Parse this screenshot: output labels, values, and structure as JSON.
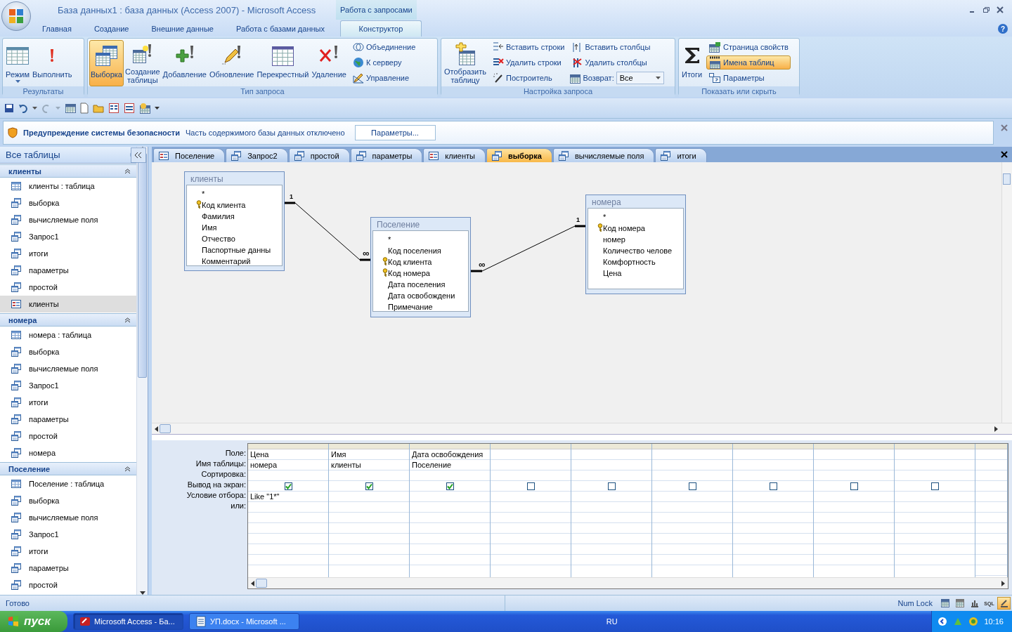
{
  "window": {
    "title": "База данных1 : база данных (Access 2007)  -  Microsoft Access",
    "context_group": "Работа с запросами",
    "help": "?"
  },
  "ribbon_tabs": [
    {
      "label": "Главная",
      "selected": false
    },
    {
      "label": "Создание",
      "selected": false
    },
    {
      "label": "Внешние данные",
      "selected": false
    },
    {
      "label": "Работа с базами данных",
      "selected": false
    },
    {
      "label": "Конструктор",
      "selected": true
    }
  ],
  "ribbon_groups": [
    {
      "title": "Результаты",
      "items": [
        {
          "kind": "large",
          "label": "Режим",
          "menu": true,
          "selected": false
        },
        {
          "kind": "large",
          "label": "Выполнить",
          "selected": false
        }
      ]
    },
    {
      "title": "Тип запроса",
      "items": [
        {
          "kind": "large",
          "label": "Выборка",
          "selected": true
        },
        {
          "kind": "large",
          "label": "Создание таблицы",
          "selected": false
        },
        {
          "kind": "large",
          "label": "Добавление",
          "selected": false
        },
        {
          "kind": "large",
          "label": "Обновление",
          "selected": false
        },
        {
          "kind": "large",
          "label": "Перекрестный",
          "selected": false
        },
        {
          "kind": "large",
          "label": "Удаление",
          "selected": false
        },
        {
          "kind": "small",
          "label": "Объединение",
          "selected": false
        },
        {
          "kind": "small",
          "label": "К серверу",
          "selected": false
        },
        {
          "kind": "small",
          "label": "Управление",
          "selected": false
        }
      ]
    },
    {
      "title": "Настройка запроса",
      "items": [
        {
          "kind": "large",
          "label": "Отобразить таблицу",
          "selected": false
        },
        {
          "kind": "small",
          "label": "Вставить строки",
          "selected": false
        },
        {
          "kind": "small",
          "label": "Удалить строки",
          "selected": false
        },
        {
          "kind": "small",
          "label": "Построитель",
          "selected": false
        },
        {
          "kind": "small",
          "label": "Вставить столбцы",
          "selected": false
        },
        {
          "kind": "small",
          "label": "Удалить столбцы",
          "selected": false
        },
        {
          "kind": "combo",
          "label": "Возврат:",
          "value": "Все"
        }
      ]
    },
    {
      "title": "Показать или скрыть",
      "items": [
        {
          "kind": "large",
          "label": "Итоги",
          "selected": false
        },
        {
          "kind": "small",
          "label": "Страница свойств",
          "selected": false
        },
        {
          "kind": "small",
          "label": "Имена таблиц",
          "selected": true
        },
        {
          "kind": "small",
          "label": "Параметры",
          "selected": false
        }
      ]
    }
  ],
  "security_bar": {
    "title": "Предупреждение системы безопасности",
    "message": "Часть содержимого базы данных отключено",
    "button": "Параметры..."
  },
  "nav_pane": {
    "title": "Все таблицы",
    "groups": [
      {
        "title": "клиенты",
        "expanded": true,
        "items": [
          {
            "label": "клиенты : таблица",
            "kind": "table",
            "selected": false
          },
          {
            "label": "выборка",
            "kind": "query",
            "selected": false
          },
          {
            "label": "вычисляемые поля",
            "kind": "query",
            "selected": false
          },
          {
            "label": "Запрос1",
            "kind": "query",
            "selected": false
          },
          {
            "label": "итоги",
            "kind": "query",
            "selected": false
          },
          {
            "label": "параметры",
            "kind": "query",
            "selected": false
          },
          {
            "label": "простой",
            "kind": "query",
            "selected": false
          },
          {
            "label": "клиенты",
            "kind": "form",
            "selected": true
          }
        ]
      },
      {
        "title": "номера",
        "expanded": true,
        "items": [
          {
            "label": "номера : таблица",
            "kind": "table",
            "selected": false
          },
          {
            "label": "выборка",
            "kind": "query",
            "selected": false
          },
          {
            "label": "вычисляемые поля",
            "kind": "query",
            "selected": false
          },
          {
            "label": "Запрос1",
            "kind": "query",
            "selected": false
          },
          {
            "label": "итоги",
            "kind": "query",
            "selected": false
          },
          {
            "label": "параметры",
            "kind": "query",
            "selected": false
          },
          {
            "label": "простой",
            "kind": "query",
            "selected": false
          },
          {
            "label": "номера",
            "kind": "query",
            "selected": false
          }
        ]
      },
      {
        "title": "Поселение",
        "expanded": true,
        "items": [
          {
            "label": "Поселение : таблица",
            "kind": "table",
            "selected": false
          },
          {
            "label": "выборка",
            "kind": "query",
            "selected": false
          },
          {
            "label": "вычисляемые поля",
            "kind": "query",
            "selected": false
          },
          {
            "label": "Запрос1",
            "kind": "query",
            "selected": false
          },
          {
            "label": "итоги",
            "kind": "query",
            "selected": false
          },
          {
            "label": "параметры",
            "kind": "query",
            "selected": false
          },
          {
            "label": "простой",
            "kind": "query",
            "selected": false
          }
        ]
      }
    ]
  },
  "doc_tabs": [
    {
      "label": "Поселение",
      "kind": "form",
      "selected": false
    },
    {
      "label": "Запрос2",
      "kind": "query",
      "selected": false
    },
    {
      "label": "простой",
      "kind": "query",
      "selected": false
    },
    {
      "label": "параметры",
      "kind": "query",
      "selected": false
    },
    {
      "label": "клиенты",
      "kind": "form",
      "selected": false
    },
    {
      "label": "выборка",
      "kind": "query",
      "selected": true
    },
    {
      "label": "вычисляемые поля",
      "kind": "query",
      "selected": false
    },
    {
      "label": "итоги",
      "kind": "query",
      "selected": false
    }
  ],
  "diagram": {
    "tables": [
      {
        "title": "клиенты",
        "fields": [
          {
            "name": "*",
            "key": false
          },
          {
            "name": "Код клиента",
            "key": true
          },
          {
            "name": "Фамилия",
            "key": false
          },
          {
            "name": "Имя",
            "key": false
          },
          {
            "name": "Отчество",
            "key": false
          },
          {
            "name": "Паспортные данны",
            "key": false
          },
          {
            "name": "Комментарий",
            "key": false
          }
        ]
      },
      {
        "title": "Поселение",
        "fields": [
          {
            "name": "*",
            "key": false
          },
          {
            "name": "Код поселения",
            "key": false
          },
          {
            "name": "Код клиента",
            "key": true
          },
          {
            "name": "Код номера",
            "key": true
          },
          {
            "name": "Дата поселения",
            "key": false
          },
          {
            "name": "Дата освобождени",
            "key": false
          },
          {
            "name": "Примечание",
            "key": false
          }
        ]
      },
      {
        "title": "номера",
        "fields": [
          {
            "name": "*",
            "key": false
          },
          {
            "name": "Код номера",
            "key": true
          },
          {
            "name": "номер",
            "key": false
          },
          {
            "name": "Количество челове",
            "key": false
          },
          {
            "name": "Комфортность",
            "key": false
          },
          {
            "name": "Цена",
            "key": false
          }
        ]
      }
    ],
    "relationships": [
      {
        "one_label": "1",
        "many_label": "∞"
      },
      {
        "one_label": "1",
        "many_label": "∞"
      }
    ]
  },
  "grid": {
    "row_labels": [
      "Поле:",
      "Имя таблицы:",
      "Сортировка:",
      "Вывод на экран:",
      "Условие отбора:",
      "или:"
    ],
    "columns": [
      {
        "field": "Цена",
        "table": "номера",
        "show": true,
        "criteria": "Like \"1*\""
      },
      {
        "field": "Имя",
        "table": "клиенты",
        "show": true
      },
      {
        "field": "Дата освобождения",
        "table": "Поселение",
        "show": true
      },
      {
        "show": false
      },
      {
        "show": false
      },
      {
        "show": false
      },
      {
        "show": false
      },
      {
        "show": false
      },
      {
        "show": false
      }
    ]
  },
  "status_bar": {
    "text": "Готово",
    "indicator": "Num Lock",
    "view_buttons": [
      {
        "kind": "datasheet",
        "selected": false
      },
      {
        "kind": "pivot",
        "selected": false
      },
      {
        "kind": "chart",
        "selected": false
      },
      {
        "kind": "sql",
        "label": "SQL",
        "selected": false
      },
      {
        "kind": "design",
        "selected": true
      }
    ]
  },
  "taskbar": {
    "start": "пуск",
    "tasks": [
      {
        "label": "Microsoft Access - Ба...",
        "kind": "access",
        "selected": true
      },
      {
        "label": "УП.docx - Microsoft ...",
        "kind": "word",
        "selected": false
      }
    ],
    "language": "RU",
    "clock": "10:16"
  }
}
